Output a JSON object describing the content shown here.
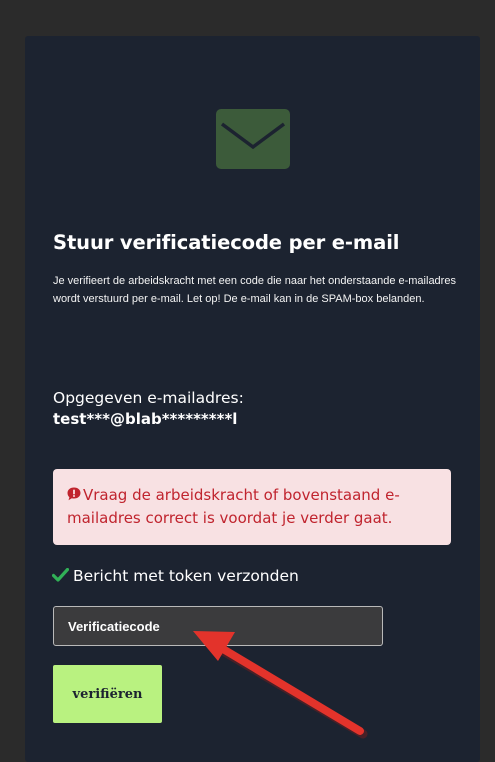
{
  "card": {
    "title": "Stuur verificatiecode per e-mail",
    "description": "Je verifieert de arbeidskracht met een code die naar het onderstaande e-mailadres wordt verstuurd per e-mail. Let op! De e-mail kan in de SPAM-box belanden.",
    "email_label": "Opgegeven e-mailadres:",
    "email_value": "test***@blab*********l",
    "alert_text": "Vraag de arbeidskracht of bovenstaand e-mailadres correct is voordat je verder gaat.",
    "status_text": "Bericht met token verzonden",
    "code_placeholder": "Verificatiecode",
    "verify_label": "verifiëren"
  },
  "icons": {
    "mail": "envelope-icon",
    "alert": "exclamation-bubble-icon",
    "status": "checkmark-icon",
    "annotation": "arrow-annotation"
  },
  "colors": {
    "page_bg": "#2b2b2b",
    "card_bg": "#1c2330",
    "envelope": "#3c5b3a",
    "alert_bg": "#f8e1e3",
    "alert_text": "#c0242e",
    "check": "#31b157",
    "button_bg": "#b9f280",
    "arrow": "#e3332b"
  }
}
